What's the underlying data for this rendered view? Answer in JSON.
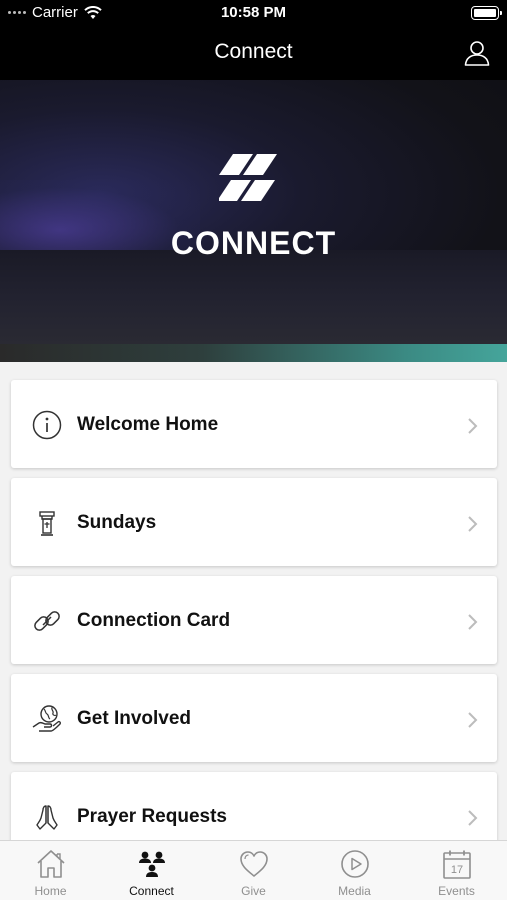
{
  "status_bar": {
    "carrier": "Carrier",
    "time": "10:58 PM"
  },
  "nav": {
    "title": "Connect",
    "profile_icon": "person-outline-icon"
  },
  "hero": {
    "title": "CONNECT",
    "logo": "double-slash-logo"
  },
  "menu": {
    "items": [
      {
        "label": "Welcome Home",
        "icon": "info-circle-icon"
      },
      {
        "label": "Sundays",
        "icon": "pulpit-icon"
      },
      {
        "label": "Connection Card",
        "icon": "link-icon"
      },
      {
        "label": "Get Involved",
        "icon": "globe-hand-icon"
      },
      {
        "label": "Prayer Requests",
        "icon": "praying-hands-icon"
      }
    ]
  },
  "tabs": [
    {
      "label": "Home",
      "icon": "home-icon",
      "active": false
    },
    {
      "label": "Connect",
      "icon": "people-icon",
      "active": true
    },
    {
      "label": "Give",
      "icon": "heart-icon",
      "active": false
    },
    {
      "label": "Media",
      "icon": "play-circle-icon",
      "active": false
    },
    {
      "label": "Events",
      "icon": "calendar-icon",
      "active": false,
      "calendar_day": "17"
    }
  ],
  "colors": {
    "bar_bg": "#000000",
    "accent_teal": "#45a59b",
    "tab_inactive": "#8f8f8f",
    "tab_active": "#111111"
  }
}
